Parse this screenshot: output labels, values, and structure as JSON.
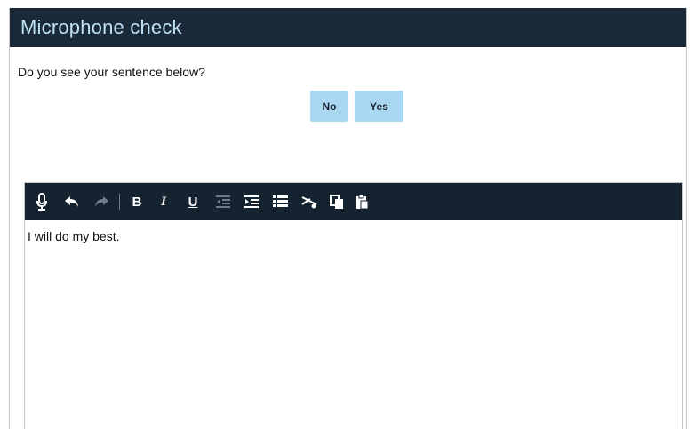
{
  "window": {
    "title": "Microphone check"
  },
  "prompt": "Do you see your sentence below?",
  "buttons": {
    "no": "No",
    "yes": "Yes"
  },
  "toolbar": {
    "tools": [
      "microphone-icon",
      "undo-icon",
      "redo-icon",
      "bold-icon",
      "italic-icon",
      "underline-icon",
      "outdent-icon",
      "indent-icon",
      "bullet-list-icon",
      "cut-icon",
      "copy-icon",
      "paste-icon"
    ],
    "bold_label": "B",
    "italic_label": "I",
    "underline_label": "U"
  },
  "editor": {
    "content": "I will do my best."
  },
  "colors": {
    "titlebar": "#1b2a38",
    "title_text": "#bfe0f6",
    "button": "#a9d7f1",
    "toolbar": "#14232f"
  }
}
